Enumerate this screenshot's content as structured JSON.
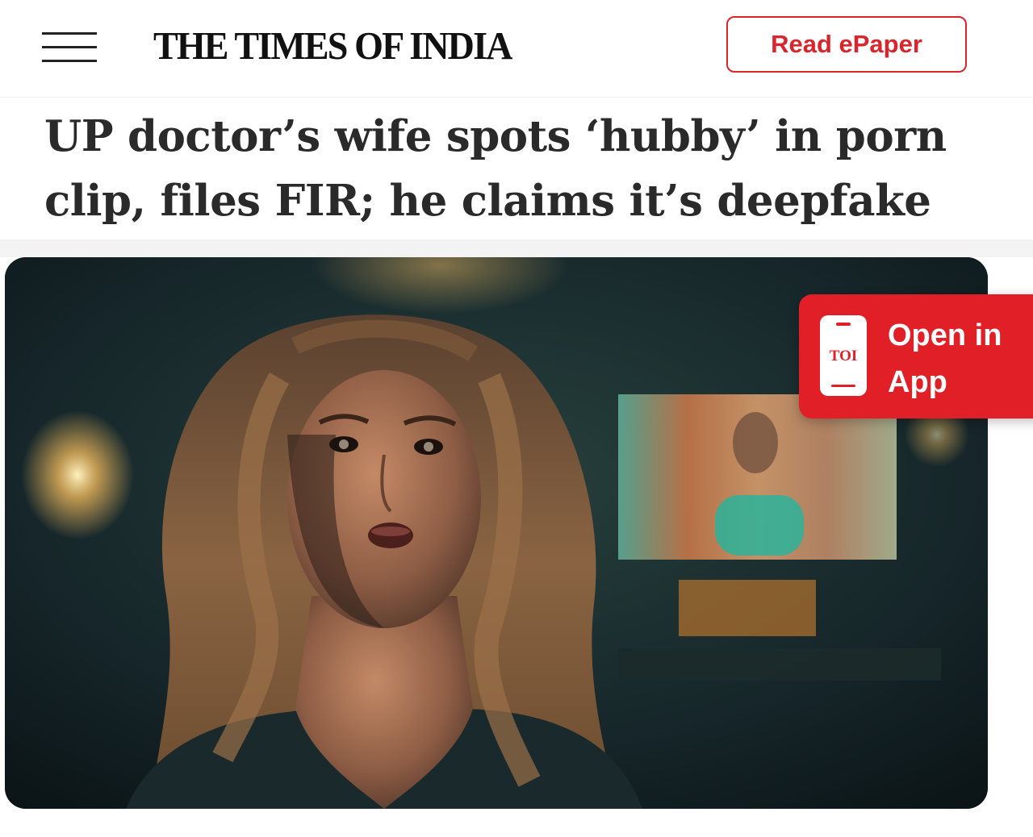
{
  "header": {
    "logo": "THE TIMES OF INDIA",
    "epaper_label": "Read ePaper",
    "menu_icon": "hamburger-menu-icon"
  },
  "article": {
    "headline": "UP doctor’s wife spots ‘hubby’ in porn clip, files FIR; he claims it’s deepfake"
  },
  "app_banner": {
    "icon_text": "TOI",
    "label": "Open in App",
    "icon": "phone-icon"
  },
  "colors": {
    "brand_red": "#e01f26",
    "epaper_red": "#d8262c",
    "headline_text": "#2a2a2a"
  }
}
